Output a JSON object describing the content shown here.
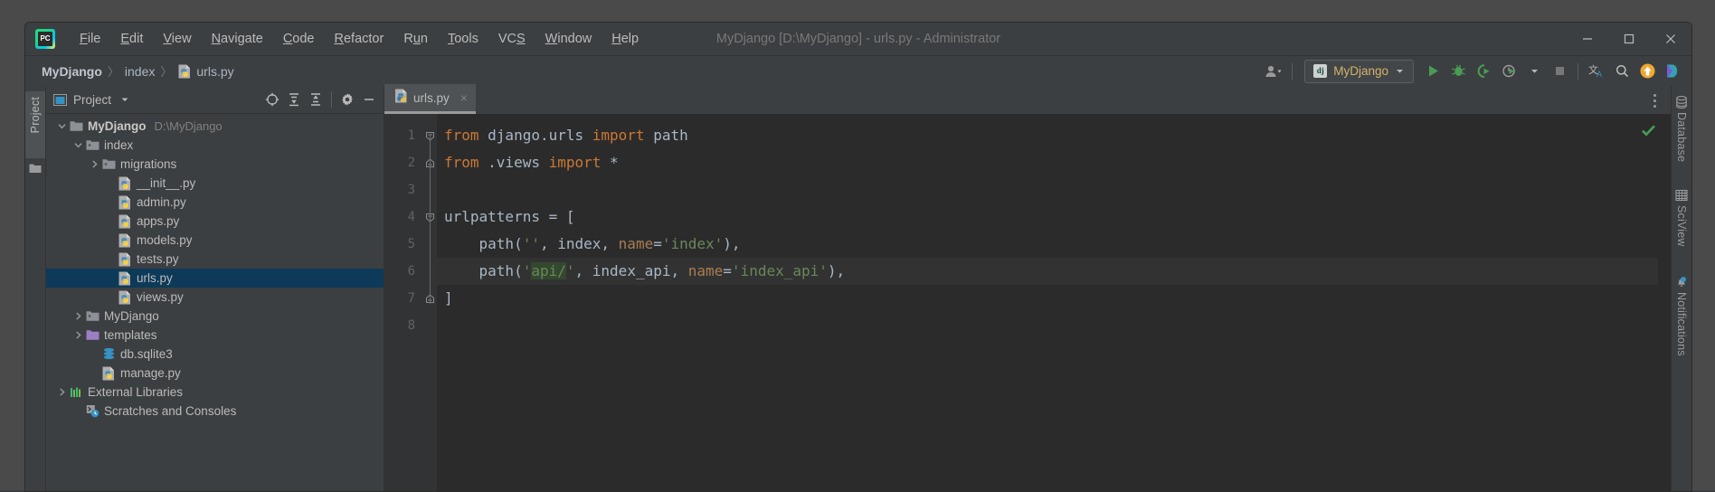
{
  "window": {
    "title": "MyDjango [D:\\MyDjango] - urls.py - Administrator",
    "minimize_label": "minimize-icon",
    "maximize_label": "maximize-icon",
    "close_label": "close-icon"
  },
  "menu": {
    "items": [
      {
        "label": "File",
        "mnemonic": "F"
      },
      {
        "label": "Edit",
        "mnemonic": "E"
      },
      {
        "label": "View",
        "mnemonic": "V"
      },
      {
        "label": "Navigate",
        "mnemonic": "N"
      },
      {
        "label": "Code",
        "mnemonic": "C"
      },
      {
        "label": "Refactor",
        "mnemonic": "R"
      },
      {
        "label": "Run",
        "mnemonic": "u"
      },
      {
        "label": "Tools",
        "mnemonic": "T"
      },
      {
        "label": "VCS",
        "mnemonic": "S"
      },
      {
        "label": "Window",
        "mnemonic": "W"
      },
      {
        "label": "Help",
        "mnemonic": "H"
      }
    ]
  },
  "navbar": {
    "breadcrumbs": [
      {
        "label": "MyDjango",
        "icon": "project-icon",
        "bold": true
      },
      {
        "label": "index",
        "icon": "folder-icon",
        "bold": false
      },
      {
        "label": "urls.py",
        "icon": "python-file-icon",
        "bold": false
      }
    ],
    "separator": "〉",
    "run_config": {
      "label": "MyDjango",
      "badge": "dj"
    },
    "buttons": [
      {
        "name": "user-settings-icon",
        "label": "User"
      },
      {
        "name": "run-button",
        "label": "Run"
      },
      {
        "name": "debug-button",
        "label": "Debug"
      },
      {
        "name": "run-with-coverage-button",
        "label": "Run with Coverage"
      },
      {
        "name": "profile-button",
        "label": "Profile"
      },
      {
        "name": "stop-button",
        "label": "Stop"
      },
      {
        "name": "translate-icon",
        "label": "Translate"
      },
      {
        "name": "search-everywhere-icon",
        "label": "Search Everywhere"
      },
      {
        "name": "update-icon",
        "label": "Update"
      },
      {
        "name": "ide-feature-icon",
        "label": "Feature"
      }
    ]
  },
  "left_strip": {
    "project_tab": "Project",
    "folder_icon": "folder-icon"
  },
  "project_panel": {
    "title": "Project",
    "dropdown_icon": "chevron-down-icon",
    "header_buttons": [
      {
        "name": "locate-icon",
        "label": "Select Opened File"
      },
      {
        "name": "expand-all-icon",
        "label": "Expand All"
      },
      {
        "name": "collapse-all-icon",
        "label": "Collapse All"
      },
      {
        "name": "gear-icon",
        "label": "Options"
      },
      {
        "name": "hide-icon",
        "label": "Hide"
      }
    ],
    "tree": [
      {
        "label": "MyDjango",
        "path": "D:\\MyDjango",
        "icon": "folder-icon",
        "indent": 0,
        "arrow": "down",
        "bold": true,
        "selected": false
      },
      {
        "label": "index",
        "path": "",
        "icon": "module-folder-icon",
        "indent": 1,
        "arrow": "down",
        "bold": false,
        "selected": false
      },
      {
        "label": "migrations",
        "path": "",
        "icon": "module-folder-icon",
        "indent": 2,
        "arrow": "right",
        "bold": false,
        "selected": false
      },
      {
        "label": "__init__.py",
        "path": "",
        "icon": "python-file-icon",
        "indent": 3,
        "arrow": "none",
        "bold": false,
        "selected": false
      },
      {
        "label": "admin.py",
        "path": "",
        "icon": "python-file-icon",
        "indent": 3,
        "arrow": "none",
        "bold": false,
        "selected": false
      },
      {
        "label": "apps.py",
        "path": "",
        "icon": "python-file-icon",
        "indent": 3,
        "arrow": "none",
        "bold": false,
        "selected": false
      },
      {
        "label": "models.py",
        "path": "",
        "icon": "python-file-icon",
        "indent": 3,
        "arrow": "none",
        "bold": false,
        "selected": false
      },
      {
        "label": "tests.py",
        "path": "",
        "icon": "python-file-icon",
        "indent": 3,
        "arrow": "none",
        "bold": false,
        "selected": false
      },
      {
        "label": "urls.py",
        "path": "",
        "icon": "python-file-icon",
        "indent": 3,
        "arrow": "none",
        "bold": false,
        "selected": true
      },
      {
        "label": "views.py",
        "path": "",
        "icon": "python-file-icon",
        "indent": 3,
        "arrow": "none",
        "bold": false,
        "selected": false
      },
      {
        "label": "MyDjango",
        "path": "",
        "icon": "module-folder-icon",
        "indent": 1,
        "arrow": "right",
        "bold": false,
        "selected": false
      },
      {
        "label": "templates",
        "path": "",
        "icon": "templates-folder-icon",
        "indent": 1,
        "arrow": "right",
        "bold": false,
        "selected": false
      },
      {
        "label": "db.sqlite3",
        "path": "",
        "icon": "database-file-icon",
        "indent": 2,
        "arrow": "none",
        "bold": false,
        "selected": false
      },
      {
        "label": "manage.py",
        "path": "",
        "icon": "python-file-icon",
        "indent": 2,
        "arrow": "none",
        "bold": false,
        "selected": false
      },
      {
        "label": "External Libraries",
        "path": "",
        "icon": "libraries-icon",
        "indent": 0,
        "arrow": "right",
        "bold": false,
        "selected": false
      },
      {
        "label": "Scratches and Consoles",
        "path": "",
        "icon": "scratches-icon",
        "indent": 1,
        "arrow": "none",
        "bold": false,
        "selected": false
      }
    ]
  },
  "editor": {
    "tabs": [
      {
        "label": "urls.py",
        "icon": "python-file-icon",
        "close": "×",
        "active": true
      }
    ],
    "inspection_status": "ok",
    "line_numbers": [
      "1",
      "2",
      "3",
      "4",
      "5",
      "6",
      "7",
      "8"
    ],
    "lines": [
      {
        "n": 1,
        "fold": "start",
        "current": false,
        "tokens": [
          {
            "t": "from",
            "c": "kw"
          },
          {
            "t": " django.urls ",
            "c": "pl"
          },
          {
            "t": "import",
            "c": "kw"
          },
          {
            "t": " path",
            "c": "pl"
          }
        ]
      },
      {
        "n": 2,
        "fold": "end",
        "current": false,
        "tokens": [
          {
            "t": "from",
            "c": "kw"
          },
          {
            "t": " .views ",
            "c": "pl"
          },
          {
            "t": "import",
            "c": "kw"
          },
          {
            "t": " *",
            "c": "pl"
          }
        ]
      },
      {
        "n": 3,
        "fold": "none",
        "current": false,
        "tokens": []
      },
      {
        "n": 4,
        "fold": "start",
        "current": false,
        "tokens": [
          {
            "t": "urlpatterns = [",
            "c": "pl"
          }
        ]
      },
      {
        "n": 5,
        "fold": "none",
        "current": false,
        "tokens": [
          {
            "t": "    path(",
            "c": "pl"
          },
          {
            "t": "''",
            "c": "str"
          },
          {
            "t": ", index, ",
            "c": "pl"
          },
          {
            "t": "name",
            "c": "kwarg"
          },
          {
            "t": "=",
            "c": "pl"
          },
          {
            "t": "'index'",
            "c": "str"
          },
          {
            "t": "),",
            "c": "pl"
          }
        ]
      },
      {
        "n": 6,
        "fold": "none",
        "current": true,
        "tokens": [
          {
            "t": "    path(",
            "c": "pl"
          },
          {
            "t": "'",
            "c": "str"
          },
          {
            "t": "api/",
            "c": "str hl"
          },
          {
            "t": "'",
            "c": "str"
          },
          {
            "t": ", index_api, ",
            "c": "pl"
          },
          {
            "t": "name",
            "c": "kwarg"
          },
          {
            "t": "=",
            "c": "pl"
          },
          {
            "t": "'index_api'",
            "c": "str"
          },
          {
            "t": "),",
            "c": "pl"
          }
        ]
      },
      {
        "n": 7,
        "fold": "end",
        "current": false,
        "tokens": [
          {
            "t": "]",
            "c": "pl"
          }
        ]
      },
      {
        "n": 8,
        "fold": "none",
        "current": false,
        "tokens": []
      }
    ]
  },
  "right_strip": {
    "tabs": [
      {
        "label": "Database",
        "icon": "database-icon",
        "badge": false
      },
      {
        "label": "SciView",
        "icon": "sciview-icon",
        "badge": false
      },
      {
        "label": "Notifications",
        "icon": "bell-icon",
        "badge": true
      }
    ]
  },
  "colors": {
    "bg": "#3c3f41",
    "editor_bg": "#2b2b2b",
    "gutter_bg": "#313335",
    "selection": "#0d3a58",
    "keyword": "#cc7832",
    "string": "#6a8759",
    "text": "#a9b7c6",
    "accent_green": "#499c54",
    "highlight": "#34472f"
  }
}
